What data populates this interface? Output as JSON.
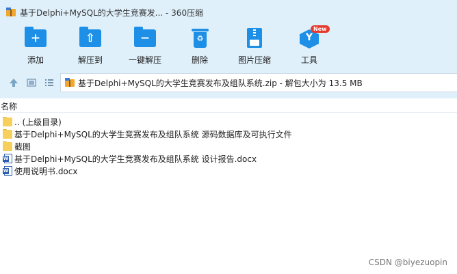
{
  "window": {
    "title": "基于Delphi+MySQL的大学生竞赛发... - 360压缩"
  },
  "toolbar": {
    "items": [
      {
        "label": "添加",
        "icon": "add-folder-icon"
      },
      {
        "label": "解压到",
        "icon": "extract-to-icon"
      },
      {
        "label": "一键解压",
        "icon": "one-click-extract-icon"
      },
      {
        "label": "删除",
        "icon": "delete-bin-icon"
      },
      {
        "label": "图片压缩",
        "icon": "image-compress-icon"
      },
      {
        "label": "工具",
        "icon": "tools-hex-icon",
        "badge": "New"
      }
    ]
  },
  "nav": {
    "address": "基于Delphi+MySQL的大学生竞赛发布及组队系统.zip - 解包大小为 13.5 MB"
  },
  "list": {
    "header": "名称",
    "rows": [
      {
        "name": ".. (上级目录)",
        "type": "folder"
      },
      {
        "name": "基于Delphi+MySQL的大学生竞赛发布及组队系统 源码数据库及可执行文件",
        "type": "folder"
      },
      {
        "name": "截图",
        "type": "folder"
      },
      {
        "name": "基于Delphi+MySQL的大学生竞赛发布及组队系统 设计报告.docx",
        "type": "docx"
      },
      {
        "name": "使用说明书.docx",
        "type": "docx"
      }
    ]
  },
  "watermark": "CSDN @biyezuopin",
  "colors": {
    "chrome_bg": "#dff0fb",
    "accent_blue": "#1e8fe6",
    "badge_red": "#e63a2e",
    "folder_yellow": "#f7cf5c"
  }
}
